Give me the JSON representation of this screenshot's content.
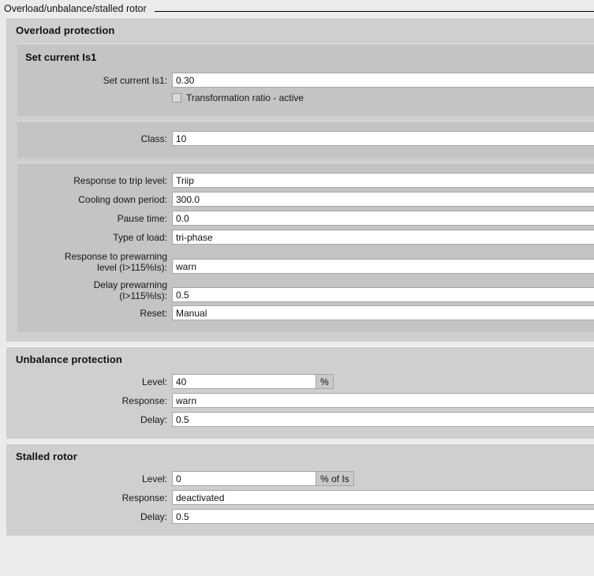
{
  "titlebar": {
    "title": "Overload/unbalance/stalled rotor"
  },
  "sections": {
    "overload": {
      "title": "Overload protection",
      "set_current": {
        "title": "Set current Is1",
        "set_current_label": "Set current Is1:",
        "set_current_value": "0.30",
        "transformation_ratio_label": "Transformation ratio - active",
        "transformation_ratio_checked": false
      },
      "class": {
        "label": "Class:",
        "value": "10"
      },
      "params": {
        "response_trip_label": "Response to trip level:",
        "response_trip_value": "Triip",
        "cooling_label": "Cooling down period:",
        "cooling_value": "300.0",
        "pause_label": "Pause time:",
        "pause_value": "0.0",
        "load_label": "Type of load:",
        "load_value": "tri-phase",
        "prewarn_response_label": "Response to prewarning\nlevel (I>115%Is):",
        "prewarn_response_value": "warn",
        "prewarn_delay_label": "Delay prewarning\n(I>115%Is):",
        "prewarn_delay_value": "0.5",
        "reset_label": "Reset:",
        "reset_value": "Manual"
      }
    },
    "unbalance": {
      "title": "Unbalance protection",
      "level_label": "Level:",
      "level_value": "40",
      "level_unit": "%",
      "response_label": "Response:",
      "response_value": "warn",
      "delay_label": "Delay:",
      "delay_value": "0.5"
    },
    "stalled": {
      "title": "Stalled rotor",
      "level_label": "Level:",
      "level_value": "0",
      "level_unit": "% of Is",
      "response_label": "Response:",
      "response_value": "deactivated",
      "delay_label": "Delay:",
      "delay_value": "0.5"
    }
  },
  "colors": {
    "page_background": "#ebebeb",
    "group_background": "#cfcfcf",
    "subpanel_background": "#c4c4c4",
    "field_background": "#ffffff",
    "unit_background": "#c9c9c9"
  }
}
